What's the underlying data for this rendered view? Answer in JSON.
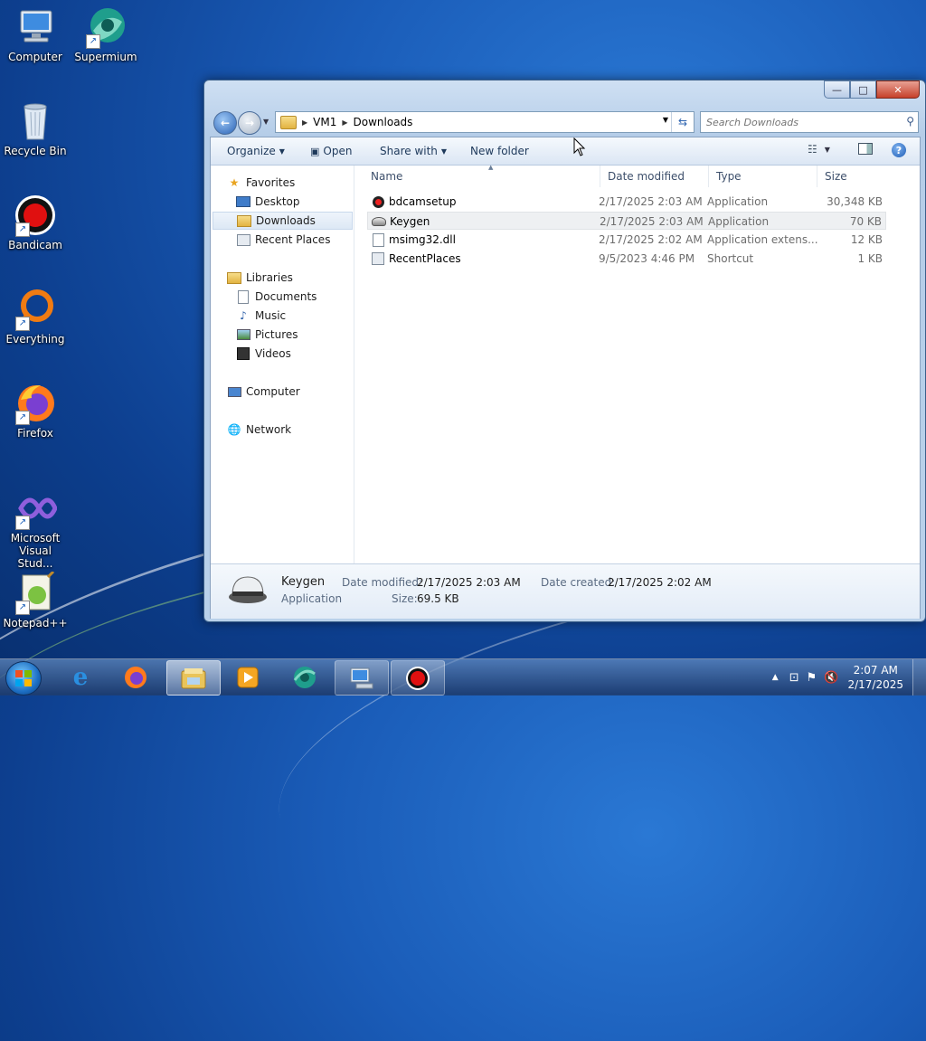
{
  "desktop": {
    "icons": [
      {
        "label": "Computer"
      },
      {
        "label": "Supermium"
      },
      {
        "label": "Recycle Bin"
      },
      {
        "label": "Bandicam"
      },
      {
        "label": "Everything"
      },
      {
        "label": "Firefox"
      },
      {
        "label": "Microsoft Visual Stud..."
      },
      {
        "label": "Notepad++"
      }
    ]
  },
  "window": {
    "caption_buttons": {
      "minimize": "—",
      "maximize": "□",
      "close": "✕"
    },
    "address": {
      "crumbs": [
        "VM1",
        "Downloads"
      ]
    },
    "search": {
      "placeholder": "Search Downloads"
    },
    "toolbar": {
      "organize": "Organize",
      "open": "Open",
      "share_with": "Share with",
      "new_folder": "New folder"
    },
    "nav": {
      "favorites": "Favorites",
      "desktop": "Desktop",
      "downloads": "Downloads",
      "recent_places": "Recent Places",
      "libraries": "Libraries",
      "documents": "Documents",
      "music": "Music",
      "pictures": "Pictures",
      "videos": "Videos",
      "computer": "Computer",
      "network": "Network"
    },
    "columns": {
      "name": "Name",
      "date_modified": "Date modified",
      "type": "Type",
      "size": "Size"
    },
    "files": [
      {
        "name": "bdcamsetup",
        "date": "2/17/2025 2:03 AM",
        "type": "Application",
        "size": "30,348 KB"
      },
      {
        "name": "Keygen",
        "date": "2/17/2025 2:03 AM",
        "type": "Application",
        "size": "70 KB"
      },
      {
        "name": "msimg32.dll",
        "date": "2/17/2025 2:02 AM",
        "type": "Application extens...",
        "size": "12 KB"
      },
      {
        "name": "RecentPlaces",
        "date": "9/5/2023 4:46 PM",
        "type": "Shortcut",
        "size": "1 KB"
      }
    ],
    "details": {
      "name": "Keygen",
      "type": "Application",
      "date_modified_label": "Date modified:",
      "date_modified": "2/17/2025 2:03 AM",
      "size_label": "Size:",
      "size": "69.5 KB",
      "date_created_label": "Date created:",
      "date_created": "2/17/2025 2:02 AM"
    }
  },
  "taskbar": {
    "clock": {
      "time": "2:07 AM",
      "date": "2/17/2025"
    },
    "tray_arrow": "▲"
  }
}
